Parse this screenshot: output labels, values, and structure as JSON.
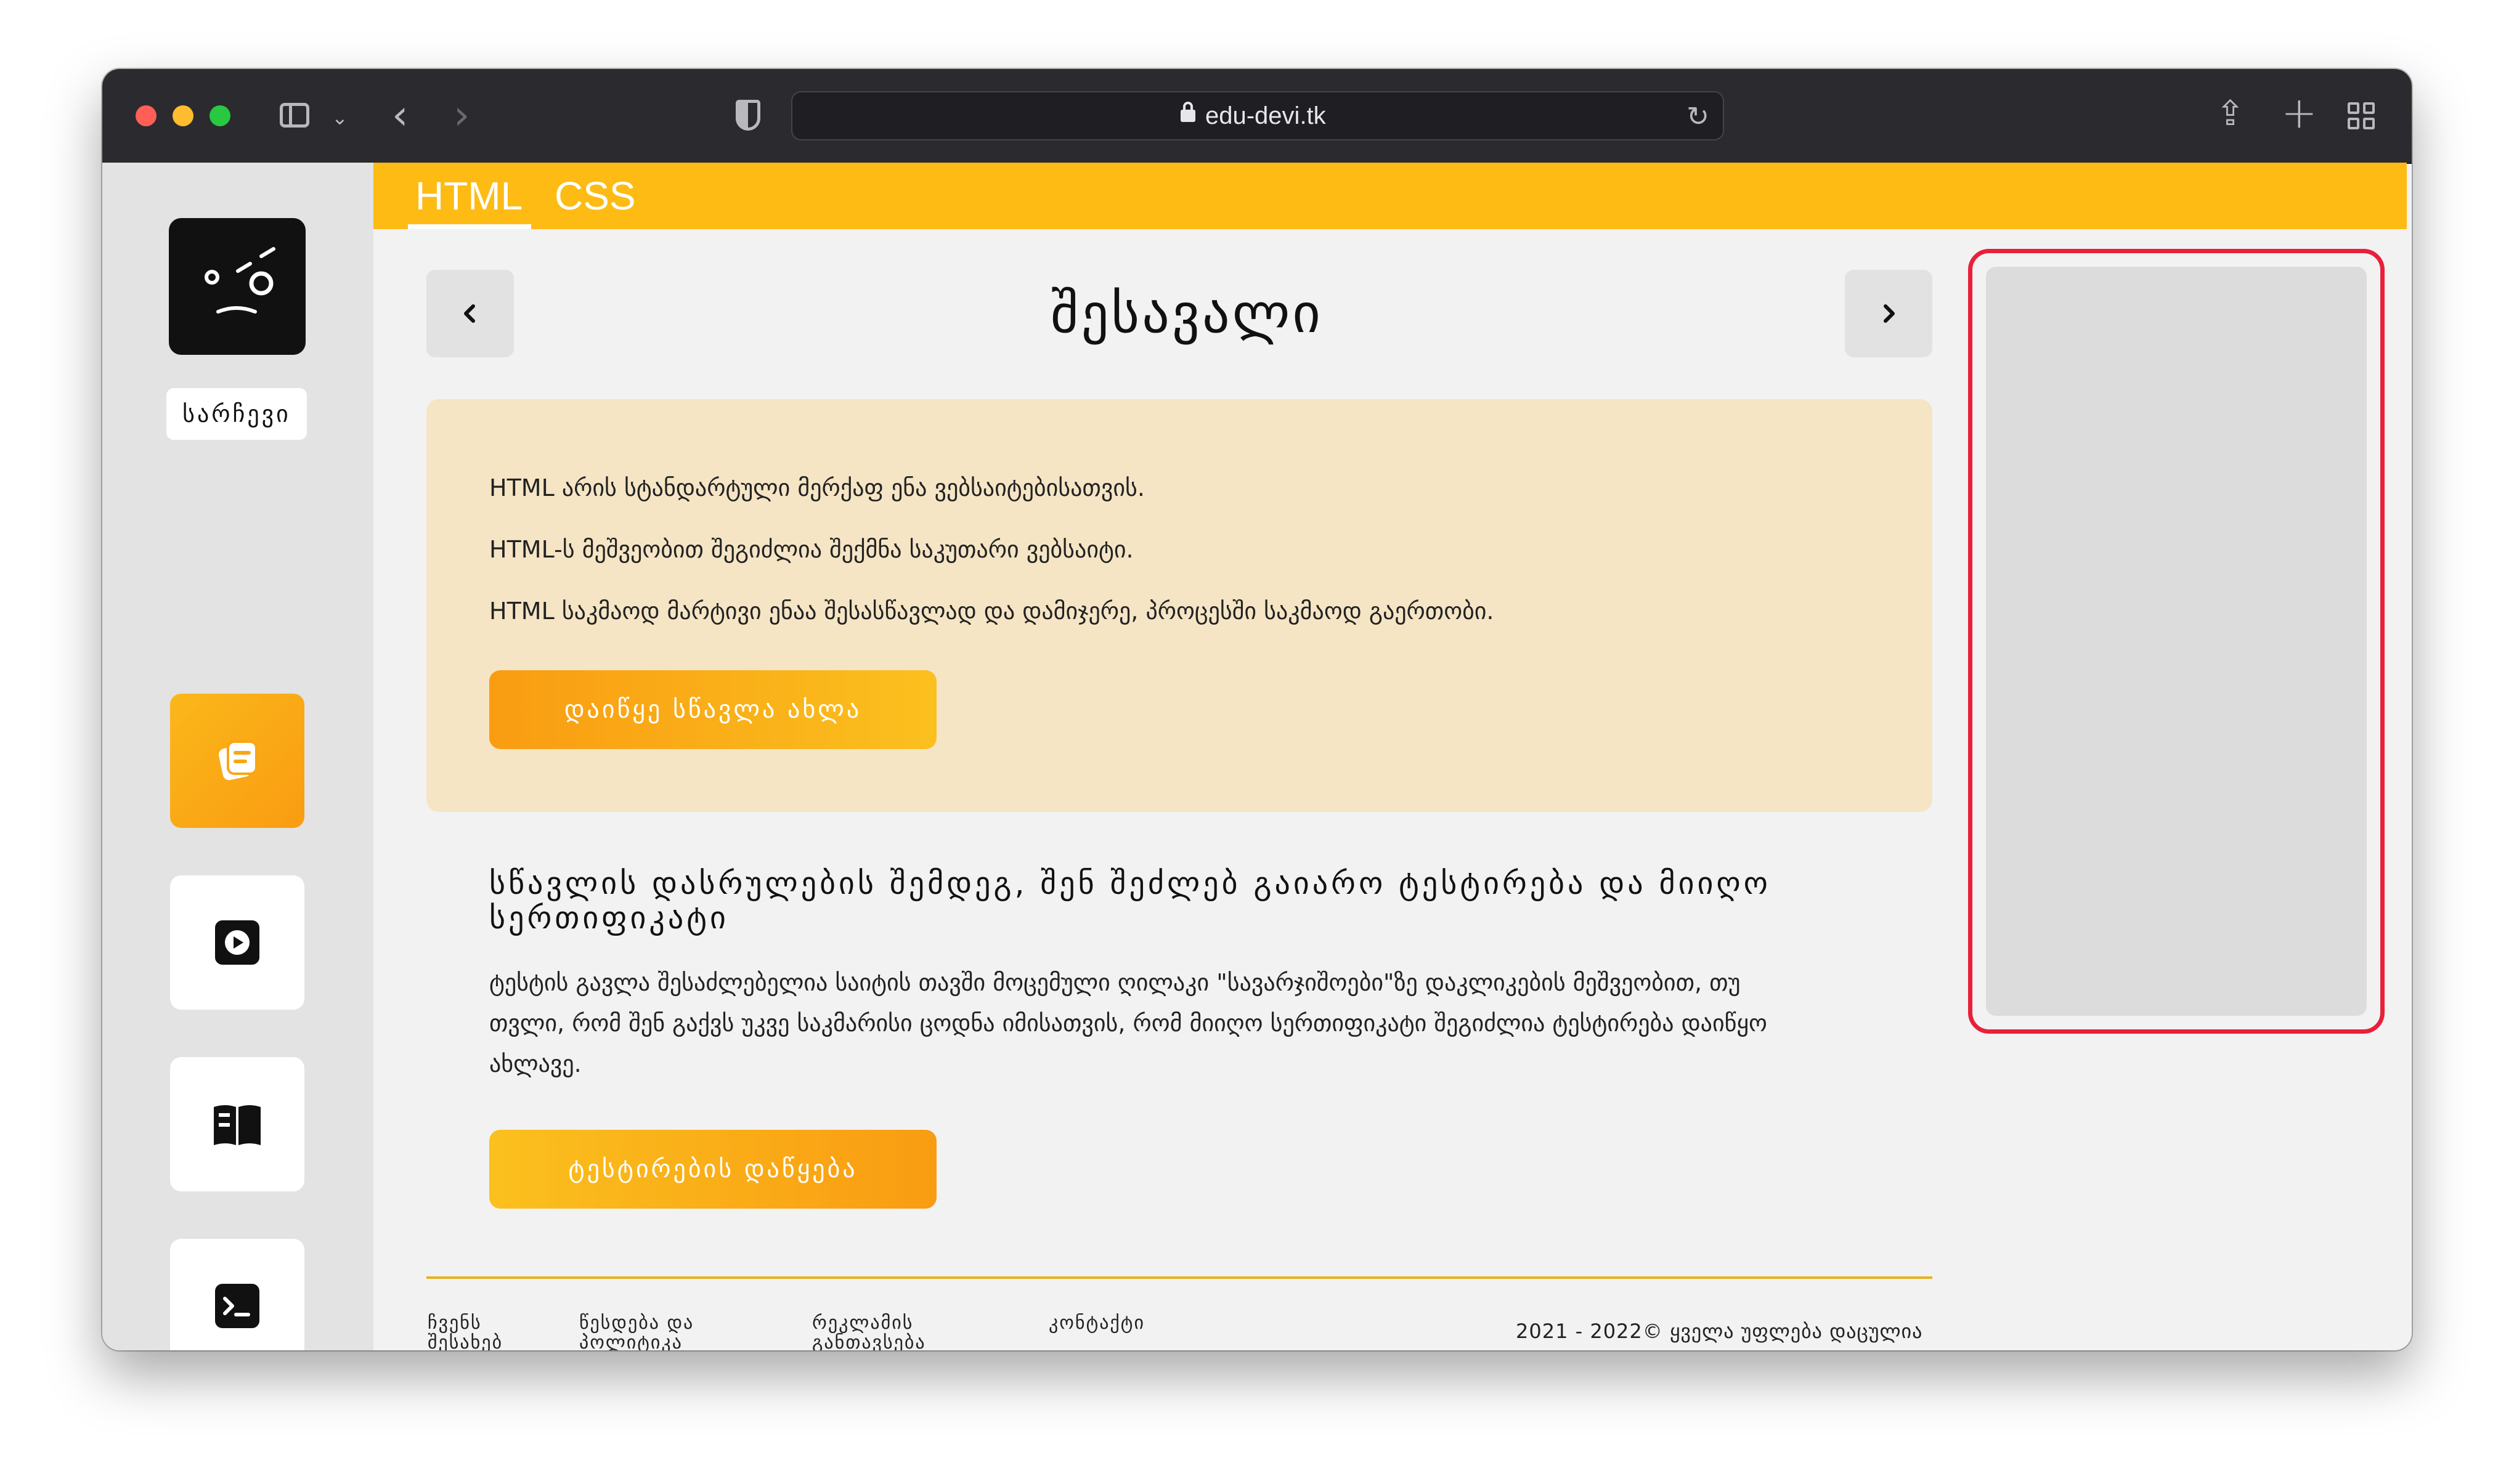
{
  "browser": {
    "url": "edu-devi.tk",
    "icons": {
      "sidebar": "sidebar-toggle-icon",
      "back": "chevron-left-icon",
      "forward": "chevron-right-icon",
      "privacy": "shield-icon",
      "lock": "lock-icon",
      "reload": "reload-icon",
      "share": "share-icon",
      "new_tab": "plus-icon",
      "tabs": "tab-overview-icon"
    }
  },
  "sidebar": {
    "random_label": "სარჩევი",
    "nav": [
      {
        "icon": "lesson-cards-icon",
        "active": true
      },
      {
        "icon": "video-play-icon",
        "active": false
      },
      {
        "icon": "book-icon",
        "active": false
      },
      {
        "icon": "terminal-icon",
        "active": false
      }
    ]
  },
  "topbar": {
    "tabs": [
      "HTML",
      "CSS"
    ],
    "active_tab": "HTML",
    "theme_icon": "moon-icon"
  },
  "page": {
    "title": "შესავალი",
    "intro_lines": [
      "HTML არის სტანდარტული მერქაფ ენა ვებსაიტებისათვის.",
      "HTML-ს მეშვეობით შეგიძლია შექმნა საკუთარი ვებსაიტი.",
      "HTML საკმაოდ მარტივი ენაა შესასწავლად და დამიჯერე, პროცესში საკმაოდ გაერთობი."
    ],
    "start_button": "დაიწყე სწავლა ახლა",
    "section_heading": "სწავლის დასრულების შემდეგ, შენ შეძლებ გაიარო ტესტირება და მიიღო სერთიფიკატი",
    "section_body": "ტესტის გავლა შესაძლებელია საიტის თავში მოცემული ღილაკი \"სავარჯიშოები\"ზე დაკლიკების მეშვეობით, თუ თვლი, რომ შენ გაქვს უკვე საკმარისი ცოდნა იმისათვის, რომ მიიღო სერთიფიკატი შეგიძლია ტესტირება დაიწყო ახლავე.",
    "test_button": "ტესტირების დაწყება"
  },
  "footer": {
    "links": [
      "ჩვენს შესახებ",
      "წესდება და პოლიტიკა",
      "რეკლამის განთავსება",
      "კონტაქტი"
    ],
    "copyright": "2021 - 2022© ყველა უფლება დაცულია"
  },
  "colors": {
    "accent": "#fdbb14",
    "button_orange": "#f99c12",
    "intro_bg": "#f5e5c5",
    "highlight_border": "#e8203a"
  }
}
